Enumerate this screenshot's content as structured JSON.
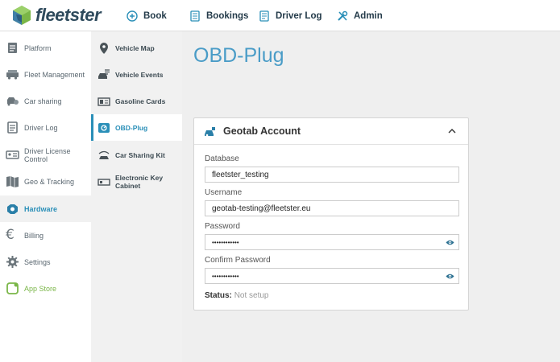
{
  "brand": {
    "name": "fleetster"
  },
  "topnav": {
    "book": "Book",
    "bookings": "Bookings",
    "driver_log": "Driver Log",
    "admin": "Admin"
  },
  "sidebar": {
    "items": [
      {
        "label": "Platform",
        "icon": "platform-icon"
      },
      {
        "label": "Fleet Management",
        "icon": "fleet-icon"
      },
      {
        "label": "Car sharing",
        "icon": "carsharing-icon"
      },
      {
        "label": "Driver Log",
        "icon": "driverlog-icon"
      },
      {
        "label": "Driver License Control",
        "icon": "license-icon"
      },
      {
        "label": "Geo & Tracking",
        "icon": "map-icon"
      },
      {
        "label": "Hardware",
        "icon": "hardware-icon"
      },
      {
        "label": "Billing",
        "icon": "euro-icon"
      },
      {
        "label": "Settings",
        "icon": "gear-icon"
      },
      {
        "label": "App Store",
        "icon": "appstore-icon"
      }
    ]
  },
  "subnav": {
    "items": [
      {
        "label": "Vehicle Map",
        "icon": "map-pin-icon"
      },
      {
        "label": "Vehicle Events",
        "icon": "vehicle-events-icon"
      },
      {
        "label": "Gasoline Cards",
        "icon": "card-icon"
      },
      {
        "label": "OBD-Plug",
        "icon": "obd-icon"
      },
      {
        "label": "Car Sharing Kit",
        "icon": "kit-icon"
      },
      {
        "label": "Electronic Key Cabinet",
        "icon": "key-cabinet-icon"
      }
    ]
  },
  "main": {
    "title": "OBD-Plug",
    "card": {
      "title": "Geotab Account",
      "database_label": "Database",
      "database_value": "fleetster_testing",
      "username_label": "Username",
      "username_value": "geotab-testing@fleetster.eu",
      "password_label": "Password",
      "password_value": "••••••••••••",
      "confirm_label": "Confirm Password",
      "confirm_value": "••••••••••••",
      "status_label": "Status:",
      "status_value": "Not setup"
    }
  },
  "colors": {
    "accent": "#2a8fb8",
    "title": "#4a9cc7",
    "brand_green": "#7ab648",
    "nav_text": "#243b4a"
  }
}
